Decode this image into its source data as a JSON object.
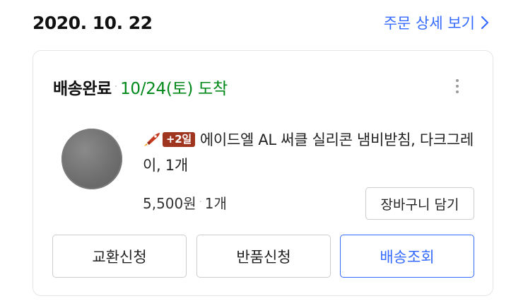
{
  "order": {
    "date": "2020. 10. 22",
    "detail_link_label": "주문 상세 보기"
  },
  "card": {
    "status": "배송완료",
    "separator": "·",
    "arrival": "10/24(토) 도착",
    "product": {
      "delivery_badge": "+2일",
      "title": "에이드엘 AL 써클 실리콘 냄비받침, 다크그레이, 1개",
      "price": "5,500원",
      "quantity": "1개"
    },
    "cart_button_label": "장바구니 담기",
    "actions": {
      "exchange_label": "교환신청",
      "return_label": "반품신청",
      "tracking_label": "배송조회"
    }
  },
  "colors": {
    "accent_blue": "#346aff",
    "arrival_green": "#00891a",
    "badge_red": "#a0351f"
  },
  "icons": [
    "chevron-right-icon",
    "more-vertical-icon",
    "rocket-icon"
  ]
}
